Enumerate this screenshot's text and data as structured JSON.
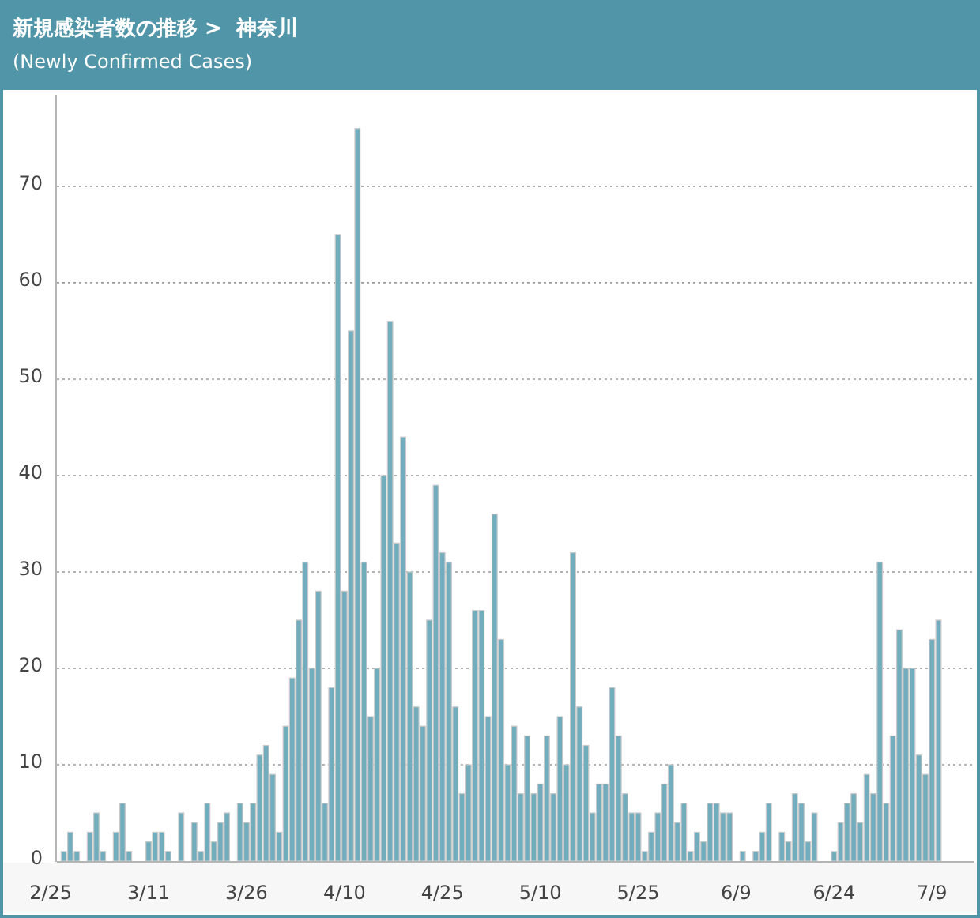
{
  "header": {
    "title": "新規感染者数の推移 >  神奈川",
    "subtitle": "(Newly Confirmed Cases)"
  },
  "chart_data": {
    "type": "bar",
    "grid": true,
    "categories": [
      "2/25",
      null,
      null,
      null,
      null,
      null,
      null,
      null,
      null,
      null,
      null,
      null,
      null,
      null,
      null,
      "3/11",
      null,
      null,
      null,
      null,
      null,
      null,
      null,
      null,
      null,
      null,
      null,
      null,
      null,
      null,
      "3/26",
      null,
      null,
      null,
      null,
      null,
      null,
      null,
      null,
      null,
      null,
      null,
      null,
      null,
      null,
      "4/10",
      null,
      null,
      null,
      null,
      null,
      null,
      null,
      null,
      null,
      null,
      null,
      null,
      null,
      null,
      "4/25",
      null,
      null,
      null,
      null,
      null,
      null,
      null,
      null,
      null,
      null,
      null,
      null,
      null,
      null,
      "5/10",
      null,
      null,
      null,
      null,
      null,
      null,
      null,
      null,
      null,
      null,
      null,
      null,
      null,
      null,
      "5/25",
      null,
      null,
      null,
      null,
      null,
      null,
      null,
      null,
      null,
      null,
      null,
      null,
      null,
      null,
      "6/9",
      null,
      null,
      null,
      null,
      null,
      null,
      null,
      null,
      null,
      null,
      null,
      null,
      null,
      null,
      "6/24",
      null,
      null,
      null,
      null,
      null,
      null,
      null,
      null,
      null,
      null,
      null,
      null,
      null,
      null,
      "7/9",
      null
    ],
    "series": [
      {
        "color": "#72adbd",
        "values": [
          null,
          null,
          1,
          3,
          1,
          0,
          3,
          5,
          1,
          0,
          3,
          6,
          1,
          0,
          0,
          2,
          3,
          3,
          1,
          0,
          5,
          0,
          4,
          1,
          6,
          2,
          4,
          5,
          0,
          6,
          4,
          6,
          11,
          12,
          9,
          3,
          14,
          19,
          25,
          31,
          20,
          28,
          6,
          18,
          65,
          28,
          55,
          76,
          31,
          15,
          20,
          40,
          56,
          33,
          44,
          30,
          16,
          14,
          25,
          39,
          32,
          31,
          16,
          7,
          10,
          26,
          26,
          15,
          36,
          23,
          10,
          14,
          7,
          13,
          7,
          8,
          13,
          7,
          15,
          10,
          32,
          16,
          12,
          5,
          8,
          8,
          18,
          13,
          7,
          5,
          5,
          1,
          3,
          5,
          8,
          10,
          4,
          6,
          1,
          3,
          2,
          6,
          6,
          5,
          5,
          0,
          1,
          0,
          1,
          3,
          6,
          0,
          3,
          2,
          7,
          6,
          2,
          5,
          0,
          0,
          1,
          4,
          6,
          7,
          4,
          9,
          7,
          31,
          6,
          13,
          24,
          20,
          20,
          11,
          9,
          23,
          25
        ]
      }
    ],
    "ylim": [
      0,
      79.5
    ],
    "yticks": [
      0,
      10,
      20,
      30,
      40,
      50,
      60,
      70
    ]
  }
}
